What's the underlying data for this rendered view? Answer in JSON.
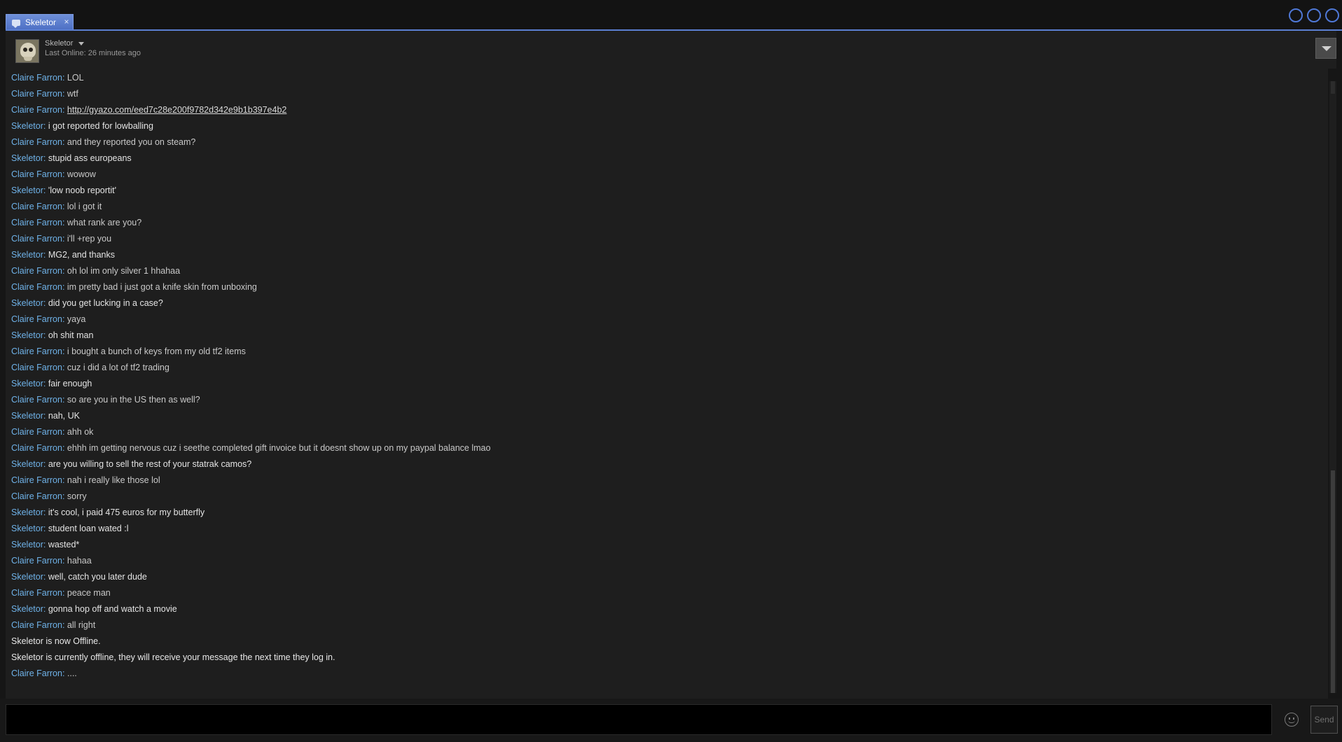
{
  "tab": {
    "label": "Skeletor",
    "close_glyph": "×",
    "icon": "chat-bubble-icon"
  },
  "window_controls": [
    "minimize-icon",
    "maximize-icon",
    "close-icon"
  ],
  "header": {
    "friend_name": "Skeletor",
    "status": "Last Online: 26 minutes ago",
    "dropdown_icon": "chevron-down-icon"
  },
  "colors": {
    "accent": "#5b7fd1",
    "sender": "#6fb2e8",
    "background": "#1e1e1e"
  },
  "messages": [
    {
      "sender": "Claire Farron",
      "text": "LOL"
    },
    {
      "sender": "Claire Farron",
      "text": "wtf"
    },
    {
      "sender": "Claire Farron",
      "text": "http://gyazo.com/eed7c28e200f9782d342e9b1b397e4b2",
      "link": true
    },
    {
      "sender": "Skeletor",
      "text": "i got reported for lowballing"
    },
    {
      "sender": "Claire Farron",
      "text": "and they reported you on steam?"
    },
    {
      "sender": "Skeletor",
      "text": "stupid ass europeans"
    },
    {
      "sender": "Claire Farron",
      "text": "wowow"
    },
    {
      "sender": "Skeletor",
      "text": "'low noob reportit'"
    },
    {
      "sender": "Claire Farron",
      "text": "lol i got it"
    },
    {
      "sender": "Claire Farron",
      "text": "what rank are you?"
    },
    {
      "sender": "Claire Farron",
      "text": "i'll +rep you"
    },
    {
      "sender": "Skeletor",
      "text": "MG2, and thanks"
    },
    {
      "sender": "Claire Farron",
      "text": "oh lol im only silver 1 hhahaa"
    },
    {
      "sender": "Claire Farron",
      "text": "im pretty bad i just got a knife skin from unboxing"
    },
    {
      "sender": "Skeletor",
      "text": "did you get lucking in a case?"
    },
    {
      "sender": "Claire Farron",
      "text": "yaya"
    },
    {
      "sender": "Skeletor",
      "text": "oh shit man"
    },
    {
      "sender": "Claire Farron",
      "text": "i bought a bunch of keys from my old tf2 items"
    },
    {
      "sender": "Claire Farron",
      "text": "cuz i did a lot of tf2 trading"
    },
    {
      "sender": "Skeletor",
      "text": "fair enough"
    },
    {
      "sender": "Claire Farron",
      "text": "so are you in the US then as well?"
    },
    {
      "sender": "Skeletor",
      "text": "nah, UK"
    },
    {
      "sender": "Claire Farron",
      "text": "ahh ok"
    },
    {
      "sender": "Claire Farron",
      "text": "ehhh im getting nervous cuz i seethe completed gift invoice but it doesnt show up on my paypal balance lmao"
    },
    {
      "sender": "Skeletor",
      "text": "are you willing to sell the rest of your statrak camos?"
    },
    {
      "sender": "Claire Farron",
      "text": "nah i really like those lol"
    },
    {
      "sender": "Claire Farron",
      "text": "sorry"
    },
    {
      "sender": "Skeletor",
      "text": "it's cool, i paid 475 euros for my butterfly"
    },
    {
      "sender": "Skeletor",
      "text": "student loan wated :l"
    },
    {
      "sender": "Skeletor",
      "text": "wasted*"
    },
    {
      "sender": "Claire Farron",
      "text": "hahaa"
    },
    {
      "sender": "Skeletor",
      "text": "well, catch you later dude"
    },
    {
      "sender": "Claire Farron",
      "text": "peace man"
    },
    {
      "sender": "Skeletor",
      "text": "gonna hop off and watch a movie"
    },
    {
      "sender": "Claire Farron",
      "text": "all right"
    },
    {
      "system": true,
      "text": "Skeletor is now Offline."
    },
    {
      "system": true,
      "text": "Skeletor is currently offline, they will receive your message the next time they log in."
    },
    {
      "sender": "Claire Farron",
      "text": "...."
    }
  ],
  "input": {
    "value": "",
    "placeholder": ""
  },
  "emoticon_icon": "smiley-icon",
  "send_label": "Send"
}
